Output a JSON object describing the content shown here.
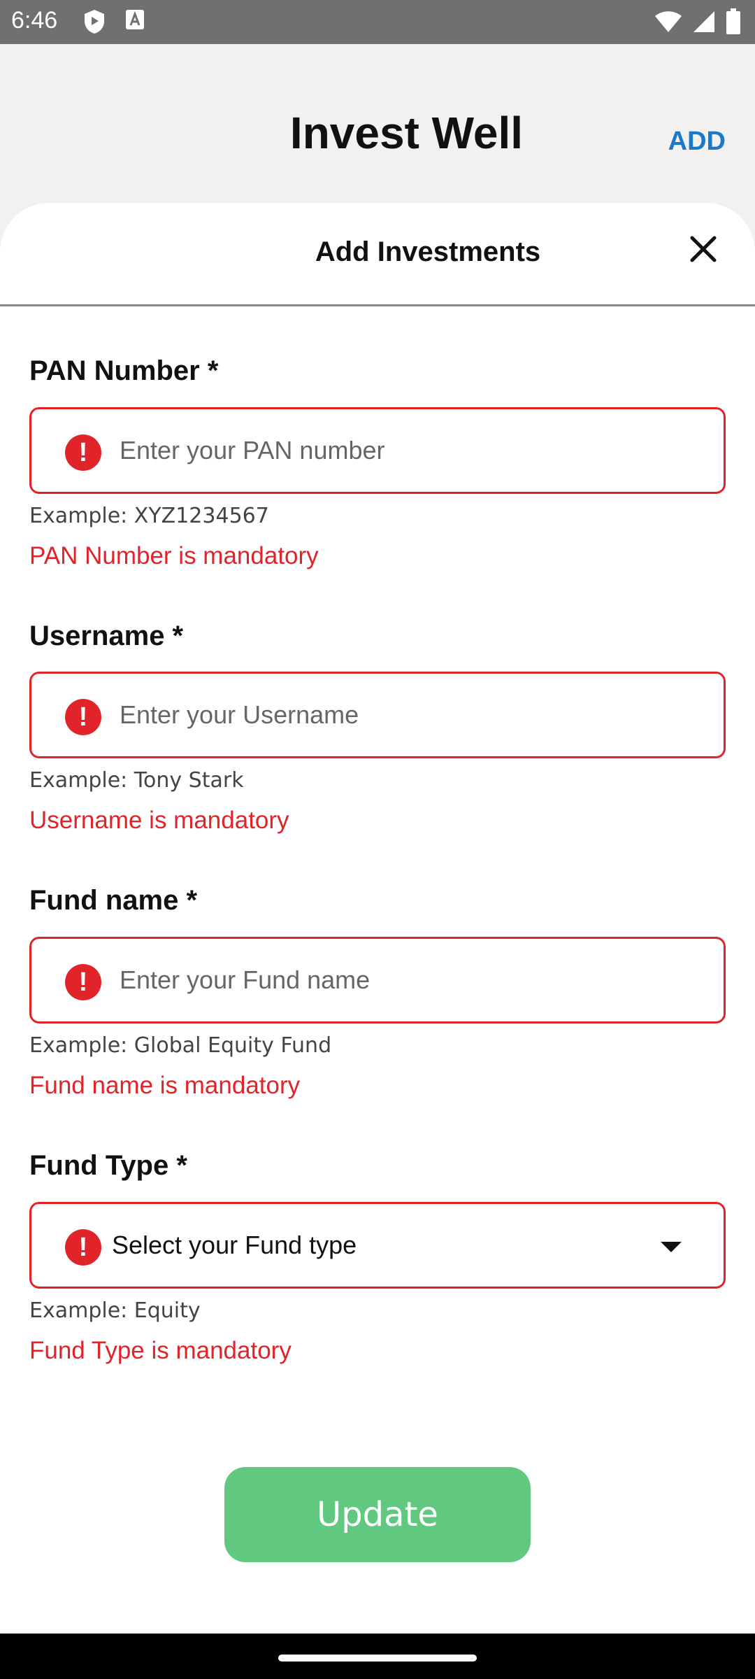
{
  "status_bar": {
    "time": "6:46"
  },
  "header": {
    "title": "Invest Well",
    "add_label": "ADD"
  },
  "sheet": {
    "title": "Add Investments",
    "fields": [
      {
        "label": "PAN Number *",
        "placeholder": "Enter your PAN number",
        "example": "Example: XYZ1234567",
        "error": "PAN Number is mandatory"
      },
      {
        "label": "Username *",
        "placeholder": "Enter your Username",
        "example": "Example: Tony Stark",
        "error": "Username is mandatory"
      },
      {
        "label": "Fund name *",
        "placeholder": "Enter your Fund name",
        "example": "Example: Global Equity Fund",
        "error": "Fund name is mandatory"
      },
      {
        "label": "Fund Type *",
        "selected": "Select your Fund type",
        "example": "Example: Equity",
        "error": "Fund Type is mandatory"
      }
    ],
    "update_label": "Update"
  },
  "colors": {
    "error": "#e0242a",
    "accent": "#1a7ac9",
    "button": "#61c880"
  }
}
